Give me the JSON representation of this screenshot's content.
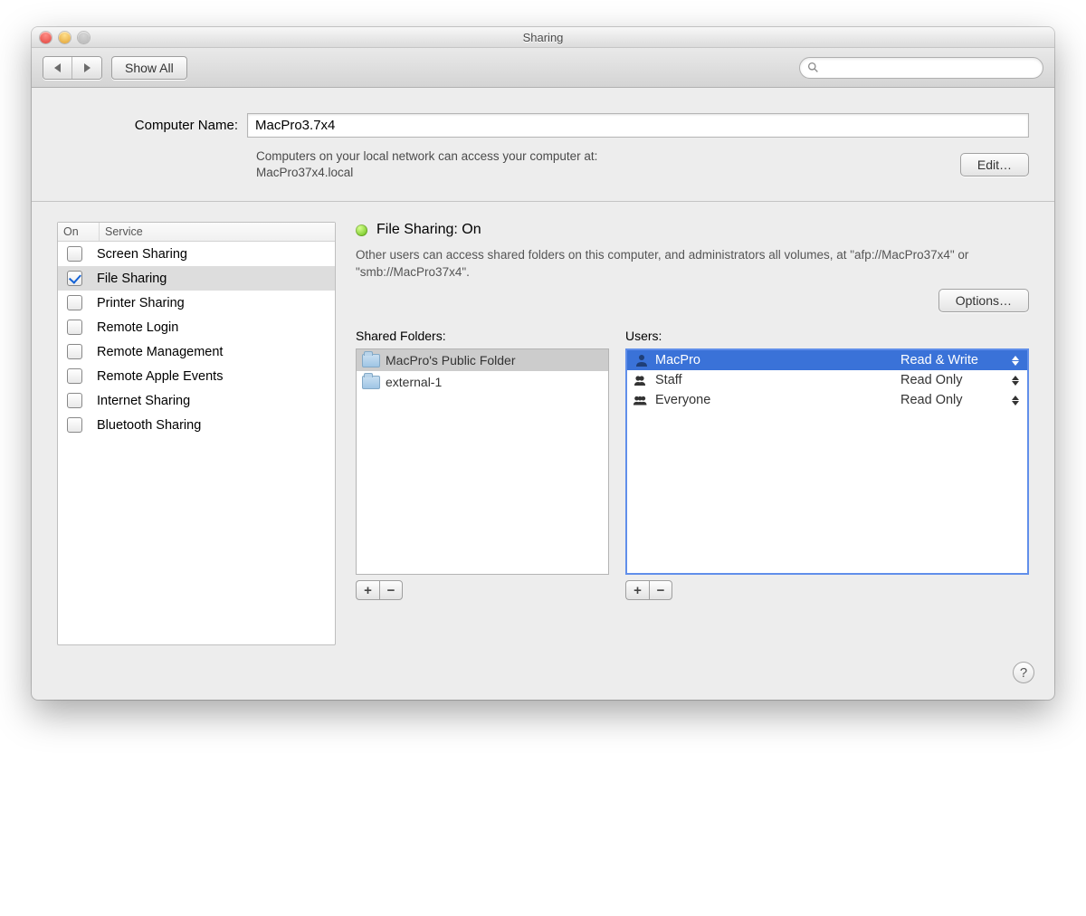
{
  "window": {
    "title": "Sharing"
  },
  "toolbar": {
    "show_all": "Show All",
    "search_placeholder": ""
  },
  "computer_name": {
    "label": "Computer Name:",
    "value": "MacPro3.7x4",
    "hint_line1": "Computers on your local network can access your computer at:",
    "hint_line2": "MacPro37x4.local",
    "edit_button": "Edit…"
  },
  "services": {
    "header_on": "On",
    "header_service": "Service",
    "items": [
      {
        "label": "Screen Sharing",
        "on": false
      },
      {
        "label": "File Sharing",
        "on": true,
        "selected": true
      },
      {
        "label": "Printer Sharing",
        "on": false
      },
      {
        "label": "Remote Login",
        "on": false
      },
      {
        "label": "Remote Management",
        "on": false
      },
      {
        "label": "Remote Apple Events",
        "on": false
      },
      {
        "label": "Internet Sharing",
        "on": false
      },
      {
        "label": "Bluetooth Sharing",
        "on": false
      }
    ]
  },
  "file_sharing": {
    "status_title": "File Sharing: On",
    "status_desc": "Other users can access shared folders on this computer, and administrators all volumes, at \"afp://MacPro37x4\" or \"smb://MacPro37x4\".",
    "options_button": "Options…",
    "shared_folders_label": "Shared Folders:",
    "users_label": "Users:",
    "folders": [
      {
        "name": "MacPro's Public Folder",
        "selected": true
      },
      {
        "name": "external-1",
        "selected": false
      }
    ],
    "users": [
      {
        "name": "MacPro",
        "perm": "Read & Write",
        "icon": "person",
        "selected": true
      },
      {
        "name": "Staff",
        "perm": "Read Only",
        "icon": "group",
        "selected": false
      },
      {
        "name": "Everyone",
        "perm": "Read Only",
        "icon": "group3",
        "selected": false
      }
    ]
  }
}
